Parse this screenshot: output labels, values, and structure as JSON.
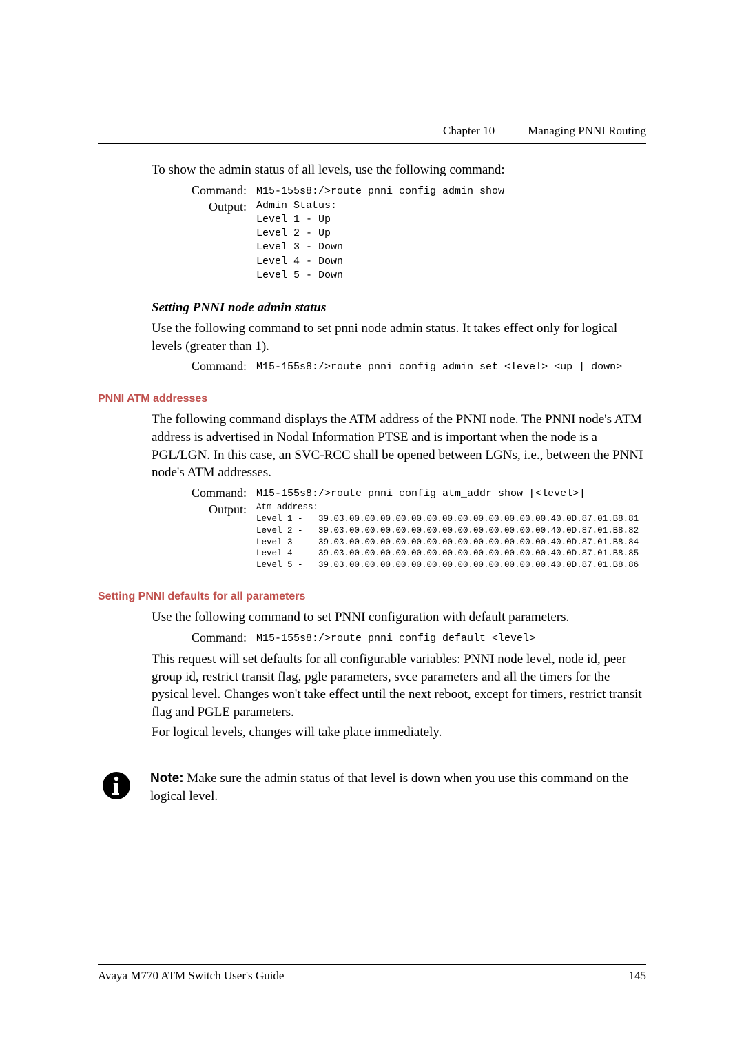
{
  "header": {
    "chapter": "Chapter 10",
    "title": "Managing PNNI Routing"
  },
  "section1": {
    "intro": "To show the admin status of all levels, use the following command:",
    "cmd_label": "Command:",
    "cmd": "M15-155s8:/>route pnni config admin show",
    "out_label": "Output:",
    "output": "Admin Status:\nLevel 1 - Up\nLevel 2 - Up\nLevel 3 - Down\nLevel 4 - Down\nLevel 5 - Down"
  },
  "section2": {
    "heading": "Setting PNNI node admin status",
    "body": "Use the following command to set pnni node admin status. It takes effect only for logical levels (greater than 1).",
    "cmd_label": "Command:",
    "cmd": "M15-155s8:/>route pnni config admin set <level> <up | down>"
  },
  "section3": {
    "heading": "PNNI ATM addresses",
    "body": "The following command displays the ATM address of the PNNI node. The PNNI node's ATM address is advertised in Nodal Information PTSE and is important when the node is a PGL/LGN. In this case, an SVC-RCC shall be opened between LGNs, i.e., between the PNNI node's ATM addresses.",
    "cmd_label": "Command:",
    "cmd": "M15-155s8:/>route pnni config atm_addr show [<level>]",
    "out_label": "Output:",
    "output": "Atm address:\nLevel 1 -   39.03.00.00.00.00.00.00.00.00.00.00.00.00.00.40.0D.87.01.B8.81\nLevel 2 -   39.03.00.00.00.00.00.00.00.00.00.00.00.00.00.40.0D.87.01.B8.82\nLevel 3 -   39.03.00.00.00.00.00.00.00.00.00.00.00.00.00.40.0D.87.01.B8.84\nLevel 4 -   39.03.00.00.00.00.00.00.00.00.00.00.00.00.00.40.0D.87.01.B8.85\nLevel 5 -   39.03.00.00.00.00.00.00.00.00.00.00.00.00.00.40.0D.87.01.B8.86"
  },
  "section4": {
    "heading": "Setting PNNI defaults for all parameters",
    "body1": "Use the following command to set PNNI configuration with default parameters.",
    "cmd_label": "Command:",
    "cmd": "M15-155s8:/>route pnni config default <level>",
    "body2": "This request will set defaults for all configurable variables: PNNI node level, node id, peer group id, restrict transit flag, pgle parameters, svce parameters and all the timers for the pysical level. Changes won't take effect until the next reboot, except for timers, restrict transit flag and PGLE parameters.",
    "body3": "For logical levels, changes will take place immediately."
  },
  "note": {
    "label": "Note:",
    "text": " Make sure the admin status of that level is down when you use this command on the logical level."
  },
  "footer": {
    "left": "Avaya M770 ATM Switch User's Guide",
    "right": "145"
  }
}
